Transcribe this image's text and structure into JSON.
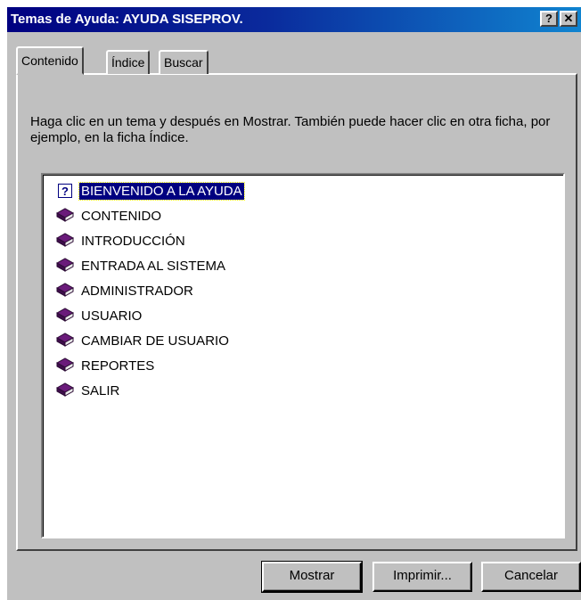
{
  "window": {
    "title": "Temas de Ayuda: AYUDA SISEPROV.",
    "help_button": "?",
    "close_button": "✕"
  },
  "tabs": [
    {
      "label": "Contenido",
      "active": true
    },
    {
      "label": "Índice",
      "active": false
    },
    {
      "label": "Buscar",
      "active": false
    }
  ],
  "instructions": "Haga clic en un tema  y después en Mostrar. También puede hacer clic en otra ficha, por ejemplo, en la ficha Índice.",
  "topics": [
    {
      "label": "BIENVENIDO A LA AYUDA",
      "icon": "help-page-icon",
      "selected": true
    },
    {
      "label": "CONTENIDO",
      "icon": "book-icon"
    },
    {
      "label": "INTRODUCCIÓN",
      "icon": "book-icon"
    },
    {
      "label": "ENTRADA AL SISTEMA",
      "icon": "book-icon"
    },
    {
      "label": "ADMINISTRADOR",
      "icon": "book-icon"
    },
    {
      "label": "USUARIO",
      "icon": "book-icon"
    },
    {
      "label": "CAMBIAR DE USUARIO",
      "icon": "book-icon"
    },
    {
      "label": "REPORTES",
      "icon": "book-icon"
    },
    {
      "label": "SALIR",
      "icon": "book-icon"
    }
  ],
  "buttons": {
    "show": "Mostrar",
    "print": "Imprimir...",
    "cancel": "Cancelar"
  },
  "colors": {
    "title_bar_start": "#000080",
    "title_bar_end": "#1084d0",
    "book": "#6a1b7a",
    "selection": "#000080"
  }
}
